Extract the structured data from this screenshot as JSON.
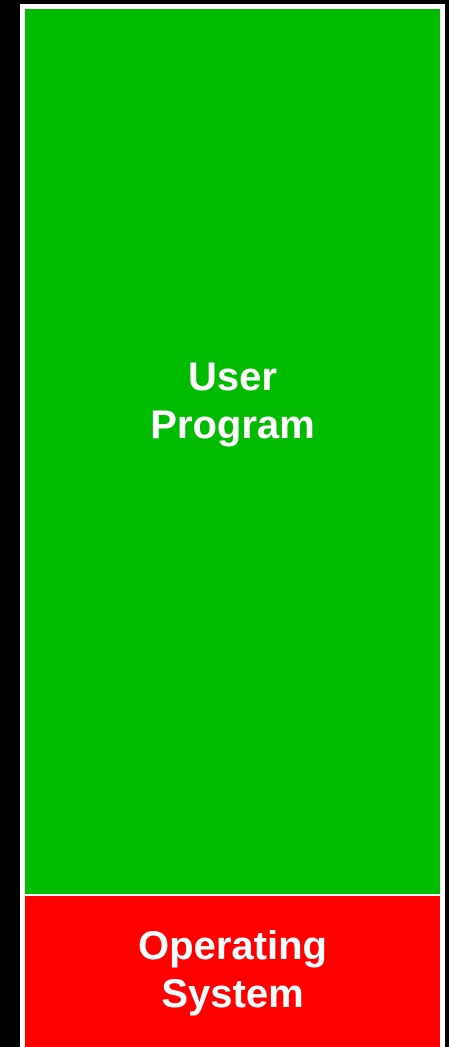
{
  "regions": {
    "user_program": {
      "line1": "User",
      "line2": "Program",
      "color": "#00bb00"
    },
    "operating_system": {
      "line1": "Operating",
      "line2": "System",
      "color": "#ff0000"
    }
  },
  "colors": {
    "background": "#000000",
    "border": "#ffffff",
    "text": "#ffffff"
  }
}
